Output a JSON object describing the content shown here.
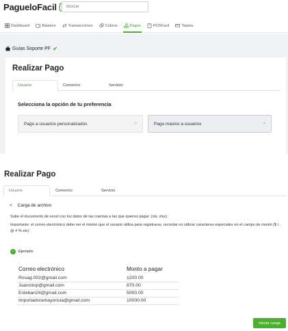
{
  "header": {
    "logo_text": "PagueloFacil",
    "search_placeholder": "Buscar"
  },
  "nav": {
    "items": [
      {
        "label": "Dashboard",
        "icon": "grid-icon"
      },
      {
        "label": "Balance",
        "icon": "wallet-icon"
      },
      {
        "label": "Transacciones",
        "icon": "transfer-icon"
      },
      {
        "label": "Cobros",
        "icon": "coins-icon"
      },
      {
        "label": "Pagos",
        "icon": "money-hand-icon",
        "active": true
      },
      {
        "label": "POSFacil",
        "icon": "pos-icon"
      },
      {
        "label": "Tarjeta",
        "icon": "card-icon"
      }
    ]
  },
  "brand": {
    "name": "Guías Soporte PF"
  },
  "panel": {
    "title": "Realizar Pago",
    "tabs": [
      "Usuario",
      "Comercio",
      "Servicio"
    ],
    "prompt": "Selecciona la opción de tu preferencia",
    "options": [
      {
        "label": "Pago a usuarios personalizados",
        "chevron": ">"
      },
      {
        "label": "Pago masivo a usuarios",
        "chevron": ">"
      }
    ]
  },
  "upload": {
    "title": "Realizar Pago",
    "tabs": [
      "Usuario",
      "Comercio",
      "Servicio"
    ],
    "back_icon": "<",
    "section_title": "Carga de archivo",
    "instruction": "Sube el documento de excel con los datos de las cuentas a las que quieres pagar: (xls, xlsx)",
    "important": "Importante: el correo electrónico debe ser el mismo que el usuario utiliza para registrarse, recordar no utilizar caracteres especiales en el campo de monto ($ / , @ # % etc)",
    "example_label": "Ejemplo:",
    "table": {
      "headers": [
        "Correo electrónico",
        "Monto a pagar"
      ],
      "rows": [
        [
          "Rosag.002@gmail.com",
          "1200.00"
        ],
        [
          "Juancitop@gmail.com",
          "870.00"
        ],
        [
          "Esteban24@gmail.com",
          "5000.00"
        ],
        [
          "Importadoramayorista@gmail.com",
          "10000.00"
        ]
      ]
    },
    "start_button": "Iniciar carga"
  },
  "colors": {
    "accent": "#4caf30",
    "panel_bg": "#f1f2f4"
  }
}
